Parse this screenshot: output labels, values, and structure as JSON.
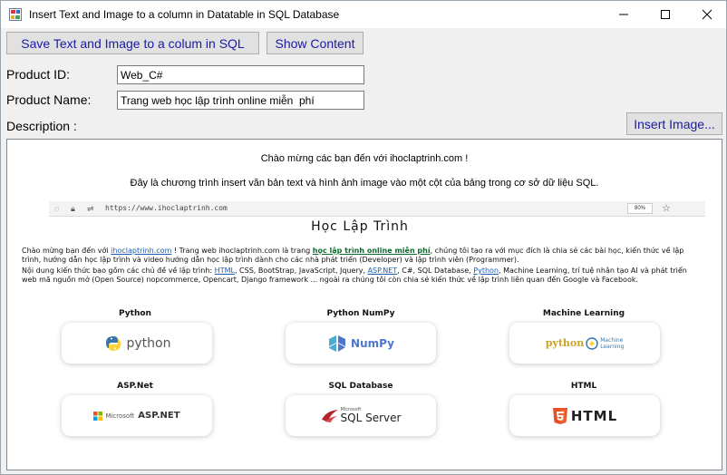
{
  "window": {
    "title": "Insert Text and Image to a column in Datatable in SQL Database",
    "controls": {
      "minimize": "—",
      "maximize": "☐",
      "close": "✕"
    }
  },
  "toolbar": {
    "save_label": "Save Text and Image to a colum in SQL",
    "show_label": "Show Content",
    "insert_image_label": "Insert Image..."
  },
  "form": {
    "product_id_label": "Product ID:",
    "product_id_value": "Web_C#",
    "product_name_label": "Product Name:",
    "product_name_value": "Trang web học lập trình online miễn  phí",
    "description_label": "Description :"
  },
  "description": {
    "intro_line1": "Chào mừng các bạn đến với ihoclaptrinh.com !",
    "intro_line2": "Đây là chương trình insert văn bản text và hình ảnh image vào một cột của bảng trong cơ sở dữ liệu SQL.",
    "screenshot": {
      "url": "https://www.ihoclaptrinh.com",
      "zoom": "80%",
      "site_title": "Học Lập Trình",
      "para1": {
        "t1": "Chào mừng bạn đến với ",
        "link1": "ihoclaptrinh.com",
        "t2": " ! Trang web ihoclaptrinh.com là trang ",
        "link2": "học lập trình online miễn phí",
        "t3": ", chúng tôi tạo ra với mục đích là chia sẻ các bài học, kiến thức về lập trình, hướng dẫn học lập trình và video hướng dẫn học lập trình dành cho các nhà phát triển (Developer) và lập trình viên (Programmer)."
      },
      "para2": {
        "t1": "Nội dung kiến thức bao gồm các chủ đề về lập trình: ",
        "html": "HTML",
        "t2": ", CSS, BootStrap, JavaScript, Jquery, ",
        "aspnet": "ASP.NET",
        "t3": ", C#, SQL Database, ",
        "python": "Python",
        "t4": ", Machine Learning, trí tuệ nhân tạo AI và phát triển web mã nguồn mở (Open Source) nopcommerce, Opencart, Django framework ... ngoài ra chúng tôi còn chia sẻ kiến thức về lập trình liên quan đến Google và Facebook."
      },
      "categories": [
        {
          "label": "Python",
          "logo": "python",
          "icon": "python-logo-icon"
        },
        {
          "label": "Python NumPy",
          "logo": "NumPy",
          "icon": "numpy-logo-icon"
        },
        {
          "label": "Machine Learning",
          "logo": "python",
          "logo_sub": "Machine Learning",
          "icon": "python-ml-logo-icon"
        },
        {
          "label": "ASP.Net",
          "logo": "ASP.NET",
          "logo_prefix": "Microsoft",
          "icon": "microsoft-logo-icon"
        },
        {
          "label": "SQL Database",
          "logo": "SQL Server",
          "logo_prefix": "Microsoft",
          "icon": "sql-server-logo-icon"
        },
        {
          "label": "HTML",
          "logo": "HTML",
          "icon": "html5-logo-icon"
        }
      ]
    }
  },
  "colors": {
    "button_text": "#1a1aa6",
    "python_blue": "#3776ab",
    "python_yellow": "#ffd43b",
    "numpy_blue": "#4dabcf",
    "html_orange": "#e34f26"
  }
}
